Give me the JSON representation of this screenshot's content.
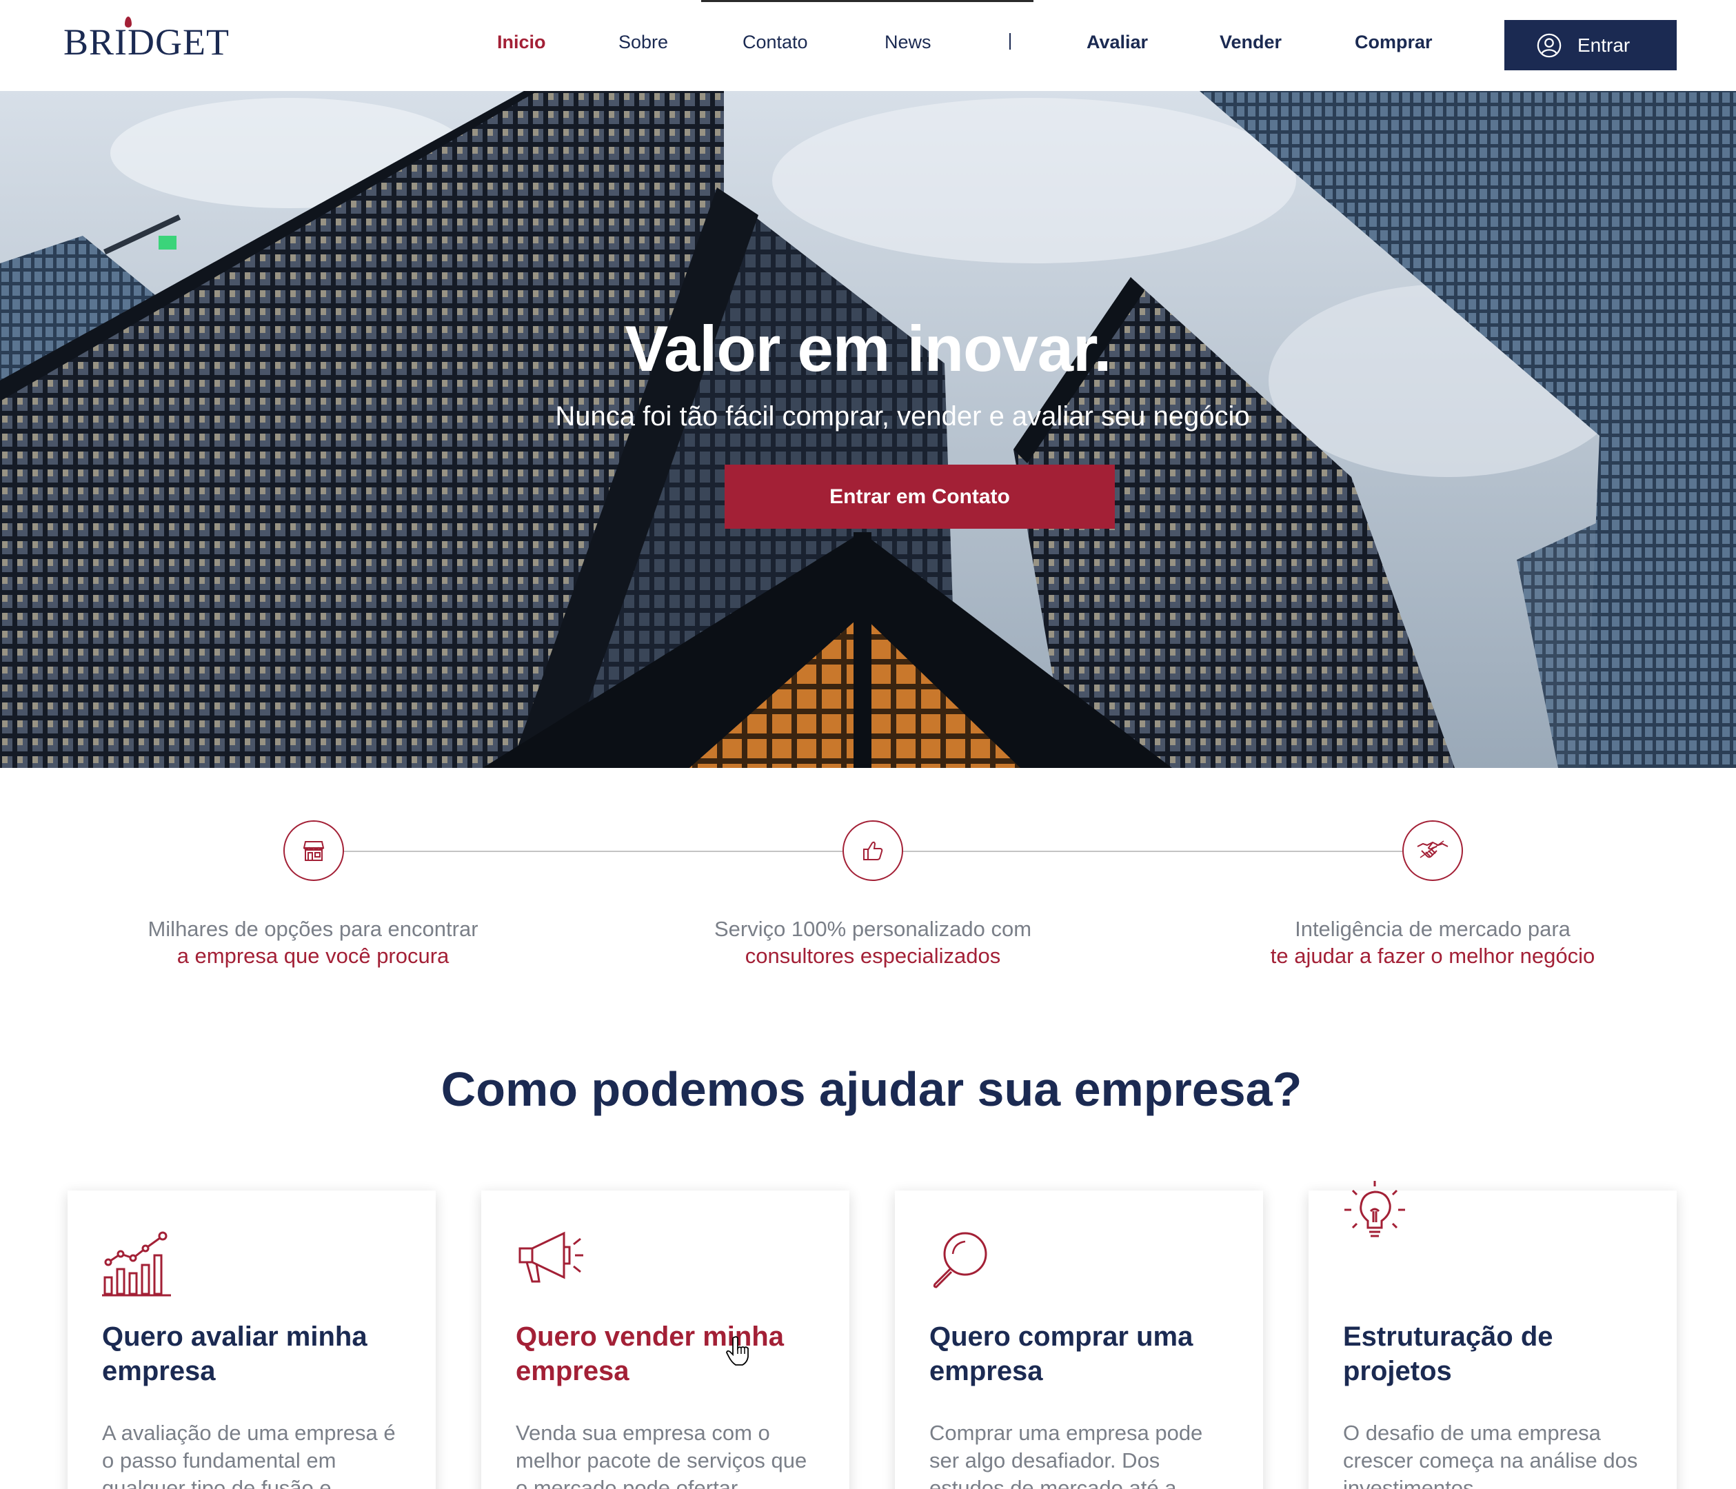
{
  "header": {
    "logo": "BRIDGET",
    "nav": [
      {
        "label": "Inicio"
      },
      {
        "label": "Sobre"
      },
      {
        "label": "Contato"
      },
      {
        "label": "News"
      },
      {
        "label": "Avaliar"
      },
      {
        "label": "Vender"
      },
      {
        "label": "Comprar"
      }
    ],
    "separator": "|",
    "login_label": "Entrar",
    "login_icon": "user-circle-icon"
  },
  "hero": {
    "title": "Valor em inovar.",
    "subtitle": "Nunca foi tão fácil comprar, vender e avaliar seu negócio",
    "cta_label": "Entrar em Contato"
  },
  "features": [
    {
      "icon": "store-icon",
      "line1": "Milhares de opções para encontrar",
      "line2": "a empresa que você procura"
    },
    {
      "icon": "thumbs-up-icon",
      "line1": "Serviço 100% personalizado com",
      "line2": "consultores especializados"
    },
    {
      "icon": "handshake-icon",
      "line1": "Inteligência de mercado para",
      "line2": "te ajudar a fazer o melhor negócio"
    }
  ],
  "section": {
    "title": "Como podemos ajudar sua empresa?"
  },
  "cards": [
    {
      "icon": "chart-growth-icon",
      "title": "Quero avaliar minha empresa",
      "text": "A avaliação de uma empresa é o passo fundamental em qualquer tipo de fusão e"
    },
    {
      "icon": "megaphone-icon",
      "title": "Quero vender minha empresa",
      "text": "Venda sua empresa com o melhor pacote de serviços que o mercado pode ofertar"
    },
    {
      "icon": "magnifier-icon",
      "title": "Quero comprar uma empresa",
      "text": "Comprar uma empresa pode ser algo desafiador. Dos estudos de mercado até a"
    },
    {
      "icon": "lightbulb-icon",
      "title": "Estruturação de projetos",
      "text": "O desafio de uma empresa crescer começa na análise dos investimentos"
    }
  ],
  "colors": {
    "brand_navy": "#1b2a52",
    "brand_red": "#a32036",
    "muted_text": "#7a7f88"
  }
}
